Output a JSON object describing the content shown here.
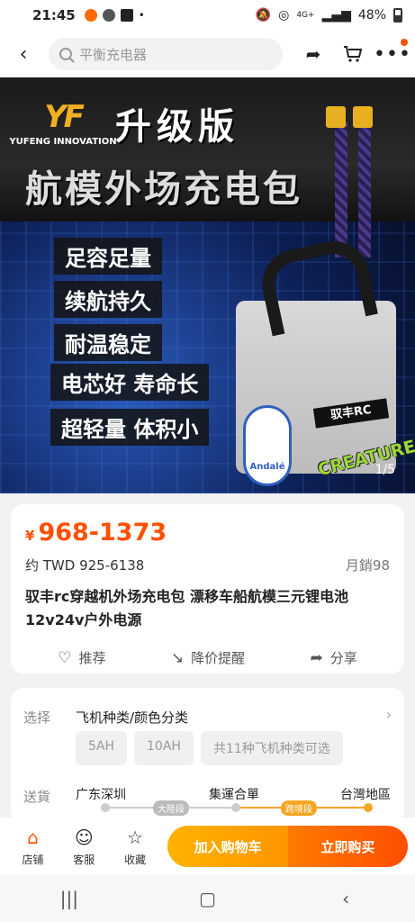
{
  "status_bar": {
    "time": "21:45",
    "network": "4G+",
    "battery": "48%"
  },
  "header": {
    "search_placeholder": "平衡充电器"
  },
  "banner": {
    "brand": "YUFENG INNOVATION",
    "headline_1": "升级版",
    "headline_2": "航模外场充电包",
    "features": [
      "足容足量",
      "续航持久",
      "耐温稳定",
      "电芯好 寿命长",
      "超轻量 体积小"
    ],
    "product_label": "驭丰RC",
    "sticker_round": "Andalé",
    "sticker_text": "CREATURE",
    "page_indicator": "1/5"
  },
  "product": {
    "currency": "¥",
    "price_range": "968-1373",
    "twd_price": "约 TWD 925-6138",
    "monthly_sales": "月銷98",
    "title": "驭丰rc穿越机外场充电包 漂移车船航模三元锂电池12v24v户外电源",
    "actions": {
      "recommend": "推荐",
      "price_alert": "降价提醒",
      "share": "分享"
    }
  },
  "options": {
    "select_label": "选择",
    "select_title": "飞机种类/颜色分类",
    "chips": [
      "5AH",
      "10AH",
      "共11种飞机种类可选"
    ],
    "shipping_label": "送貨",
    "shipping": {
      "from": "广东深圳",
      "via": "集運合單",
      "to": "台灣地區",
      "seg1": "大陸段",
      "seg2": "跨境段"
    }
  },
  "bottom_bar": {
    "store": "店铺",
    "service": "客服",
    "favorite": "收藏",
    "add_cart": "加入购物车",
    "buy_now": "立即购买"
  },
  "colors": {
    "accent": "#ff5000",
    "cart_button": "#ffa000",
    "buy_button": "#ff5a00"
  }
}
